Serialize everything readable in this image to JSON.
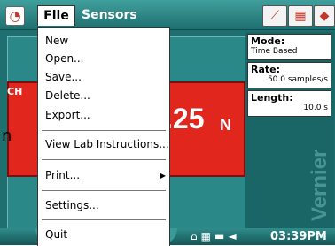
{
  "menubar": {
    "file_label": "File",
    "sensors_label": "Sensors"
  },
  "file_menu": {
    "items": [
      {
        "label": "New"
      },
      {
        "label": "Open..."
      },
      {
        "label": "Save..."
      },
      {
        "label": "Delete..."
      },
      {
        "label": "Export..."
      },
      {
        "label": "View Lab Instructions..."
      },
      {
        "label": "Print...",
        "has_submenu": true
      },
      {
        "label": "Settings..."
      },
      {
        "label": "Quit"
      }
    ]
  },
  "meter": {
    "channel_label": "CH",
    "value": ".25",
    "unit": "N",
    "stub_text": "n",
    "color": "#e0261d"
  },
  "info": {
    "mode_title": "Mode:",
    "mode_value": "Time Based",
    "rate_title": "Rate:",
    "rate_value": "50.0 samples/s",
    "length_title": "Length:",
    "length_value": "10.0 s"
  },
  "watermark": "Vernier",
  "status": {
    "time": "03:39PM"
  },
  "icons": {
    "app": "gauge-icon",
    "graph": "graph-view-icon",
    "table": "table-view-icon",
    "meter": "meter-view-icon"
  },
  "colors": {
    "teal_dark": "#1f6f70",
    "teal_mid": "#2a8888",
    "meter_red": "#e0261d"
  }
}
